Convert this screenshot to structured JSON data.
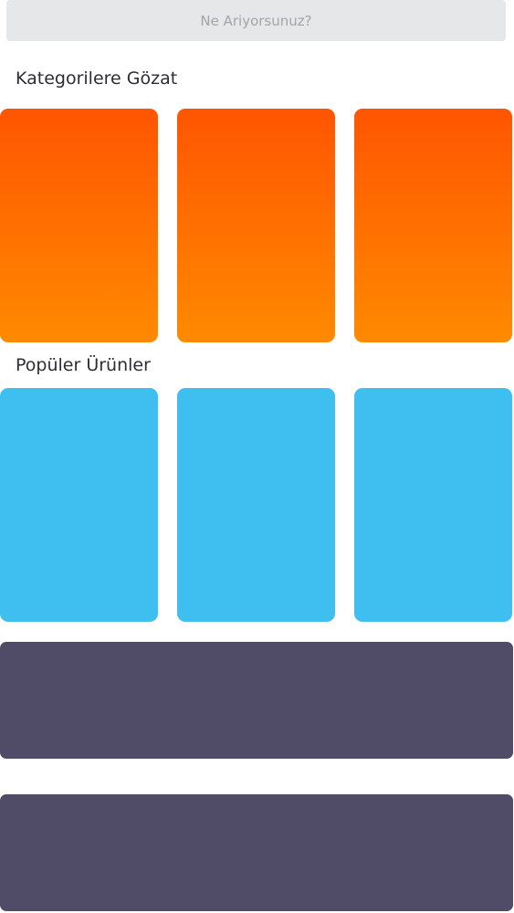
{
  "search": {
    "placeholder": "Ne Ariyorsunuz?"
  },
  "sections": {
    "categories_title": "Kategorilere Gözat",
    "popular_title": "Popüler Ürünler"
  },
  "colors": {
    "search_bg": "#e6e7e9",
    "category_gradient_top": "#ff5500",
    "category_gradient_bottom": "#ff8a00",
    "popular_card": "#3fbff0",
    "banner": "#504c68"
  }
}
